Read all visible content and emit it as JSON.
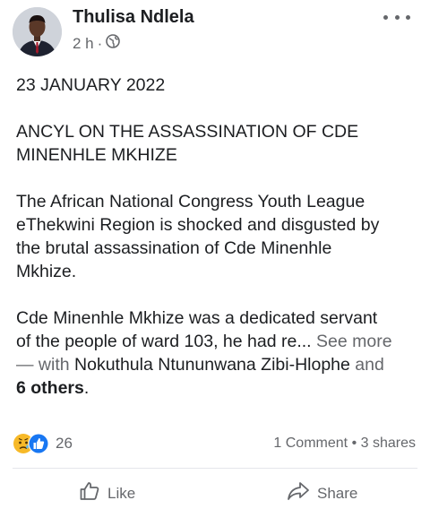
{
  "post": {
    "author": "Thulisa Ndlela",
    "time": "2 h",
    "separator": "·",
    "privacy_icon": "globe-icon",
    "more_icon": "more-options-icon",
    "date_line": "23 JANUARY 2022",
    "headline_line1": "ANCYL ON THE ASSASSINATION OF CDE",
    "headline_line2": "MINENHLE MKHIZE",
    "para1_l1": "The African National Congress Youth League",
    "para1_l2": "eThekwini Region is shocked and disgusted by",
    "para1_l3": "the brutal assassination of Cde Minenhle",
    "para1_l4": "Mkhize.",
    "para2_l1": "Cde Minenhle Mkhize was a dedicated servant",
    "para2_l2_text": "of the people of ward 103, he had re... ",
    "see_more": "See more",
    "with_text": "— with ",
    "tagged_name": "Nokuthula Ntununwana Zibi-Hlophe",
    "and_text": " and",
    "others_text": "6 others",
    "period": "."
  },
  "reactions": {
    "count": "26",
    "icons": [
      "sad-reaction-icon",
      "like-reaction-icon"
    ],
    "colors": {
      "like": "#1877f2",
      "sad": "#f7b928"
    }
  },
  "stats": {
    "comments": "1 Comment",
    "dot": "•",
    "shares": "3 shares"
  },
  "actions": {
    "like_label": "Like",
    "share_label": "Share"
  }
}
